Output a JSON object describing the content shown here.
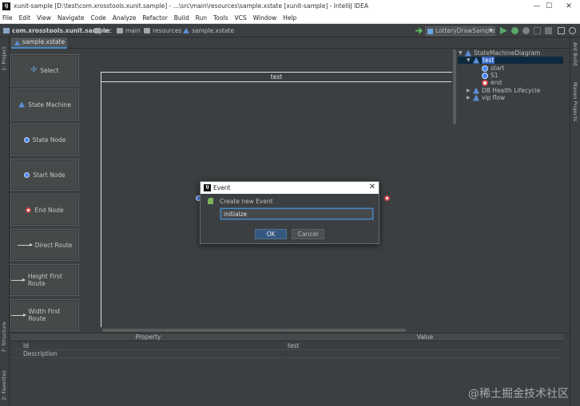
{
  "window": {
    "title": "xunit-sample [D:\\test\\com.xrosstools.xunit.sample] - ...\\src\\main\\resources\\sample.xstate [xunit-sample] - IntelliJ IDEA",
    "app_icon_text": "IJ",
    "minimize": "—",
    "maximize": "☐",
    "close": "✕"
  },
  "menu": [
    "File",
    "Edit",
    "View",
    "Navigate",
    "Code",
    "Analyze",
    "Refactor",
    "Build",
    "Run",
    "Tools",
    "VCS",
    "Window",
    "Help"
  ],
  "breadcrumb": {
    "project": "com.xrosstools.xunit.sample",
    "items": [
      "src",
      "main",
      "resources",
      "sample.xstate"
    ]
  },
  "toolbar": {
    "run_config": "LotteryDrawSample"
  },
  "tab": {
    "label": "sample.xstate"
  },
  "left_stripe": {
    "project": "1: Project",
    "structure": "7: Structure",
    "favorites": "2: Favorites"
  },
  "right_stripe": {
    "ant": "Ant Build",
    "maven": "Maven Projects"
  },
  "palette": [
    {
      "label": "Select",
      "icon": "select-icon"
    },
    {
      "label": "State Machine",
      "icon": "state-machine-icon"
    },
    {
      "label": "State Node",
      "icon": "state-node-icon"
    },
    {
      "label": "Start Node",
      "icon": "start-node-icon"
    },
    {
      "label": "End Node",
      "icon": "end-node-icon"
    },
    {
      "label": "Direct Route",
      "icon": "arrow-icon"
    },
    {
      "label": "Height First Route",
      "icon": "arrow-icon"
    },
    {
      "label": "Width First Route",
      "icon": "arrow-icon"
    }
  ],
  "diagram": {
    "state_machine_name": "test"
  },
  "tree": {
    "root": "StateMachineDiagram",
    "selected": "test",
    "children": [
      "start",
      "S1",
      "end"
    ],
    "others": [
      "DB Health Lifecycle",
      "vip flow"
    ]
  },
  "properties": {
    "header_property": "Property",
    "header_value": "Value",
    "rows": [
      {
        "property": "Id",
        "value": "test"
      },
      {
        "property": "Description",
        "value": ""
      }
    ]
  },
  "dialog": {
    "title": "Event",
    "label": "Create new Event",
    "input_value": "initialze",
    "ok": "OK",
    "cancel": "Cancel"
  },
  "watermark": "@稀土掘金技术社区",
  "colors": {
    "accent": "#4a88c7",
    "background": "#3c3f41",
    "selection": "#0d293e"
  }
}
